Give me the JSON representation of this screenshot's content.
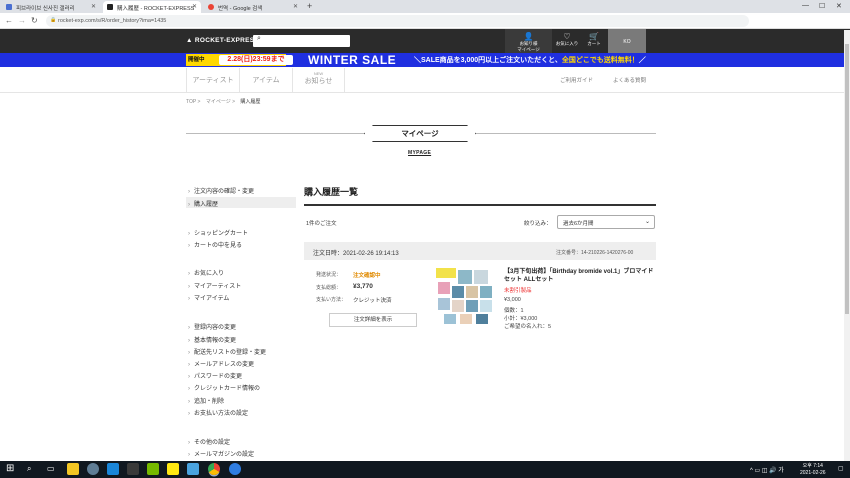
{
  "browser": {
    "tabs": [
      {
        "label": "피브라이브 신사진 갤러리",
        "active": false
      },
      {
        "label": "購入履歴 - ROCKET-EXPRESS",
        "active": true
      },
      {
        "label": "번역 - Google 검색",
        "active": false
      }
    ],
    "url": "rocket-exp.com/s/R/order_history?ima=1435"
  },
  "site": {
    "logo": "ROCKET-EXPRESS",
    "header_icons": [
      {
        "label": "お知り様\nマイページ",
        "icon": "user-icon"
      },
      {
        "label": "お気に入り",
        "icon": "heart-icon"
      },
      {
        "label": "カート",
        "icon": "cart-icon"
      }
    ],
    "user_label": "KO"
  },
  "banner": {
    "badge": "開催中",
    "date": "2.28(日)23:59まで",
    "title": "WINTER SALE",
    "promo_pre": "＼SALE商品を3,000円以上ご注文いただくと、",
    "promo_highlight": "全国どこでも送料無料！",
    "promo_post": "／"
  },
  "nav": {
    "items": [
      "アーティスト",
      "アイテム",
      "お知らせ"
    ],
    "new_label": "NEW",
    "guide": "ご利用ガイド",
    "faq": "よくある質問"
  },
  "breadcrumb": [
    "TOP",
    "マイページ",
    "購入履歴"
  ],
  "heading": {
    "title": "マイページ",
    "sub": "MYPAGE"
  },
  "sidebar": {
    "groups": [
      [
        "注文内容の確認・変更",
        "購入履歴"
      ],
      [
        "ショッピングカート",
        "カートの中を見る"
      ],
      [
        "お気に入り",
        "マイアーティスト",
        "マイアイテム"
      ],
      [
        "登録内容の変更",
        "基本情報の変更",
        "配送先リストの登録・変更",
        "メールアドレスの変更",
        "パスワードの変更",
        "クレジットカード情報の",
        "追加・削除",
        "お支払い方法の設定"
      ],
      [
        "その他の設定",
        "メールマガジンの設定"
      ]
    ]
  },
  "main": {
    "title": "購入履歴一覧",
    "count": "1件のご注文",
    "filter_label": "絞り込み：",
    "filter_value": "過去6か月間",
    "order": {
      "date": "注文日時：2021-02-26 19:14:13",
      "number": "注文番号：14-210226-1420276-00",
      "status_label": "発送状況：",
      "status_value": "注文確認中",
      "amount_label": "支払総額：",
      "amount_value": "¥3,770",
      "method_label": "支払い方法：",
      "method_value": "クレジット決済",
      "detail_button": "注文詳細を表示"
    },
    "product": {
      "name": "【3月下旬出荷】「Birthday bromide vol.1」ブロマイドセット ALLセット",
      "status": "未割引製品",
      "price": "¥3,000",
      "qty": "個数：1",
      "subtotal": "小計：¥3,000",
      "names": "ご希望の名入れ：5"
    }
  },
  "taskbar": {
    "time": "오후 7:14",
    "date": "2021-02-26"
  }
}
